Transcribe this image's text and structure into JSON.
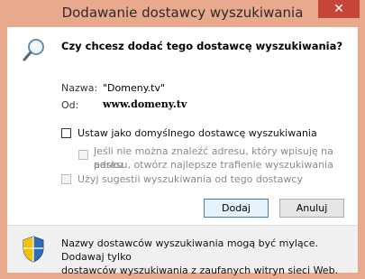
{
  "window": {
    "title": "Dodawanie dostawcy wyszukiwania",
    "close_glyph": "✕"
  },
  "dialog": {
    "question": "Czy chcesz dodać tego dostawcę wyszukiwania?",
    "name_label": "Nazwa:",
    "name_value": "\"Domeny.tv\"",
    "from_label": "Od:",
    "from_value": "www.domeny.tv",
    "default_checkbox_label": "Ustaw jako domyślnego dostawcę wyszukiwania",
    "default_checked": false,
    "best_match_label_line1": "Jeśli nie można znaleźć adresu, który wpisuję na pasku",
    "best_match_label_line2": "adresu, otwórz najlepsze trafienie wyszukiwania",
    "best_match_checked": false,
    "suggestions_label": "Użyj sugestii wyszukiwania od tego dostawcy",
    "suggestions_checked": false,
    "add_button": "Dodaj",
    "cancel_button": "Anuluj"
  },
  "footer": {
    "warning_line1": "Nazwy dostawców wyszukiwania mogą być mylące. Dodawaj tylko",
    "warning_line2": "dostawców wyszukiwania z zaufanych witryn sieci Web."
  },
  "icons": {
    "search": "magnifier-icon",
    "shield": "security-shield-icon"
  },
  "colors": {
    "titlebar": "#e8a98d",
    "close": "#c7463a",
    "footer_bg": "#f0f0f0"
  }
}
